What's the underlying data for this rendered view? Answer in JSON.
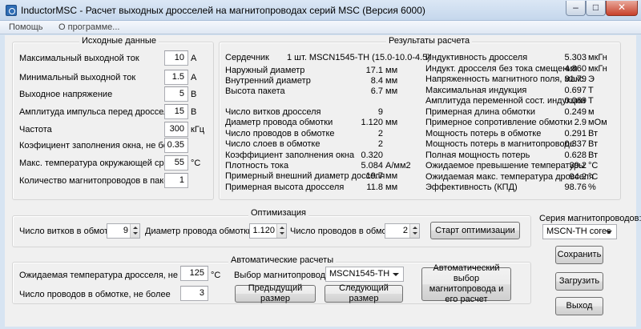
{
  "window": {
    "title": "InductorMSC - Расчет выходных дросселей на магнитопроводах серий MSC (Версия 6000)",
    "minimize": "–",
    "maximize": "□",
    "close": "✕"
  },
  "menu": [
    "Помощь",
    "О программе..."
  ],
  "input_group": {
    "title": "Исходные данные",
    "fields": [
      {
        "label": "Максимальный выходной ток",
        "value": "10",
        "unit": "А"
      },
      {
        "label": "Минимальный выходной ток",
        "value": "1.5",
        "unit": "А"
      },
      {
        "label": "Выходное напряжение",
        "value": "5",
        "unit": "В"
      },
      {
        "label": "Амплитуда импульса перед дросселем",
        "value": "15",
        "unit": "В"
      },
      {
        "label": "Частота",
        "value": "300",
        "unit": "кГц"
      },
      {
        "label": "Коэфициент заполнения окна, не более",
        "value": "0.35",
        "unit": ""
      },
      {
        "label": "Макс. температура окружающей среды",
        "value": "55",
        "unit": "°С"
      },
      {
        "label": "Количество магнитопроводов  в пакете",
        "value": "1",
        "unit": ""
      }
    ]
  },
  "results_group": {
    "title": "Результаты расчета",
    "core_label": "Сердечник",
    "core_value": "1 шт. MSCN1545-TH (15.0-10.0-4.5)",
    "left_top": [
      {
        "label": "Наружный диаметр",
        "value": "17.1",
        "unit": "мм"
      },
      {
        "label": "Внутренний диаметр",
        "value": "8.4",
        "unit": "мм"
      },
      {
        "label": "Высота пакета",
        "value": "6.7",
        "unit": "мм"
      }
    ],
    "left_bottom": [
      {
        "label": "Число витков дросселя",
        "value": "9",
        "unit": ""
      },
      {
        "label": "Диаметр провода обмотки",
        "value": "1.120",
        "unit": "мм"
      },
      {
        "label": "Число проводов в обмотке",
        "value": "2",
        "unit": ""
      },
      {
        "label": "Число слоев в обмотке",
        "value": "2",
        "unit": ""
      },
      {
        "label": "Коэффициент заполнения окна",
        "value": "0.320",
        "unit": ""
      },
      {
        "label": "Плотность тока",
        "value": "5.084",
        "unit": "А/мм2"
      },
      {
        "label": "Примерный внешний диаметр досселя",
        "value": "19.7",
        "unit": "мм"
      },
      {
        "label": "Примерная высота дросселя",
        "value": "11.8",
        "unit": "мм"
      }
    ],
    "right": [
      {
        "label": "Индуктивность дросселя",
        "value": "5.303",
        "unit": "мкГн"
      },
      {
        "label": "Индукт. дросселя без тока смещения",
        "value": "4.860",
        "unit": "мкГн"
      },
      {
        "label": "Напряженность магнитного поля, макс.",
        "value": "31.79",
        "unit": "Э"
      },
      {
        "label": "Максимальная индукция",
        "value": "0.697",
        "unit": "Т"
      },
      {
        "label": "Амплитуда переменной сост. индукции",
        "value": "0.069",
        "unit": "Т"
      },
      {
        "label": "Примерная длина обмотки",
        "value": "0.249",
        "unit": "м"
      },
      {
        "label": "Примерное сопротивление обмотки",
        "value": "2.9",
        "unit": "мОм"
      },
      {
        "label": "Мощность потерь в обмотке",
        "value": "0.291",
        "unit": "Вт"
      },
      {
        "label": "Мощность потерь в магнитопроводе",
        "value": "0.337",
        "unit": "Вт"
      },
      {
        "label": "Полная мощность потерь",
        "value": "0.628",
        "unit": "Вт"
      },
      {
        "label": "Ожидаемое превышение температуры",
        "value": "39.2",
        "unit": "°С"
      },
      {
        "label": "Ожидаемая макс. температура дросселя",
        "value": "94.2",
        "unit": "°С"
      },
      {
        "label": "Эффективность (КПД)",
        "value": "98.76",
        "unit": "%"
      }
    ]
  },
  "optimization": {
    "title": "Оптимизация",
    "turns_label": "Число витков в обмотке",
    "turns_value": "9",
    "diameter_label": "Диаметр провода обмотки, мм",
    "diameter_value": "1.120",
    "wires_label": "Число проводов в обмотке",
    "wires_value": "2",
    "start_button": "Старт оптимизации"
  },
  "series": {
    "label": "Серия магнитопроводов:",
    "value": "MSCN-TH cores"
  },
  "auto": {
    "title": "Автоматические расчеты",
    "temp_label": "Ожидаемая температура дросселя, не более",
    "temp_value": "125",
    "temp_unit": "°С",
    "wires_label": "Число проводов в обмотке, не более",
    "wires_value": "3",
    "core_select_label": "Выбор магнитопровода:",
    "core_select_value": "MSCN1545-TH",
    "prev_button": "Предыдущий размер",
    "next_button": "Следующий размер",
    "auto_button": "Автоматический выбор магнитопровода и его расчет"
  },
  "side_buttons": {
    "save": "Сохранить",
    "load": "Загрузить",
    "exit": "Выход"
  }
}
